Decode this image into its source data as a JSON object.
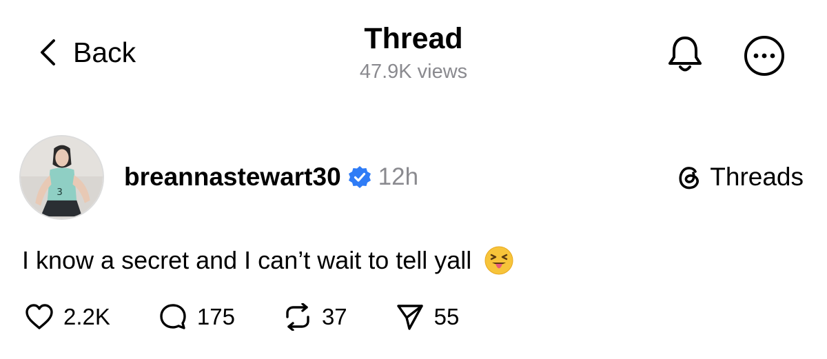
{
  "header": {
    "back_label": "Back",
    "title": "Thread",
    "views": "47.9K views",
    "icons": [
      "chevron-left-icon",
      "bell-icon",
      "more-icon"
    ]
  },
  "post": {
    "username": "breannastewart30",
    "verified": true,
    "time": "12h",
    "platform_label": "Threads",
    "text": "I know a secret and I can’t wait to tell yall",
    "emoji": "😝",
    "actions": {
      "likes": "2.2K",
      "replies": "175",
      "reposts": "37",
      "shares": "55"
    }
  },
  "colors": {
    "text": "#000000",
    "muted": "#8a8a8f",
    "verified_badge": "#2f7cf6",
    "background": "#ffffff"
  }
}
